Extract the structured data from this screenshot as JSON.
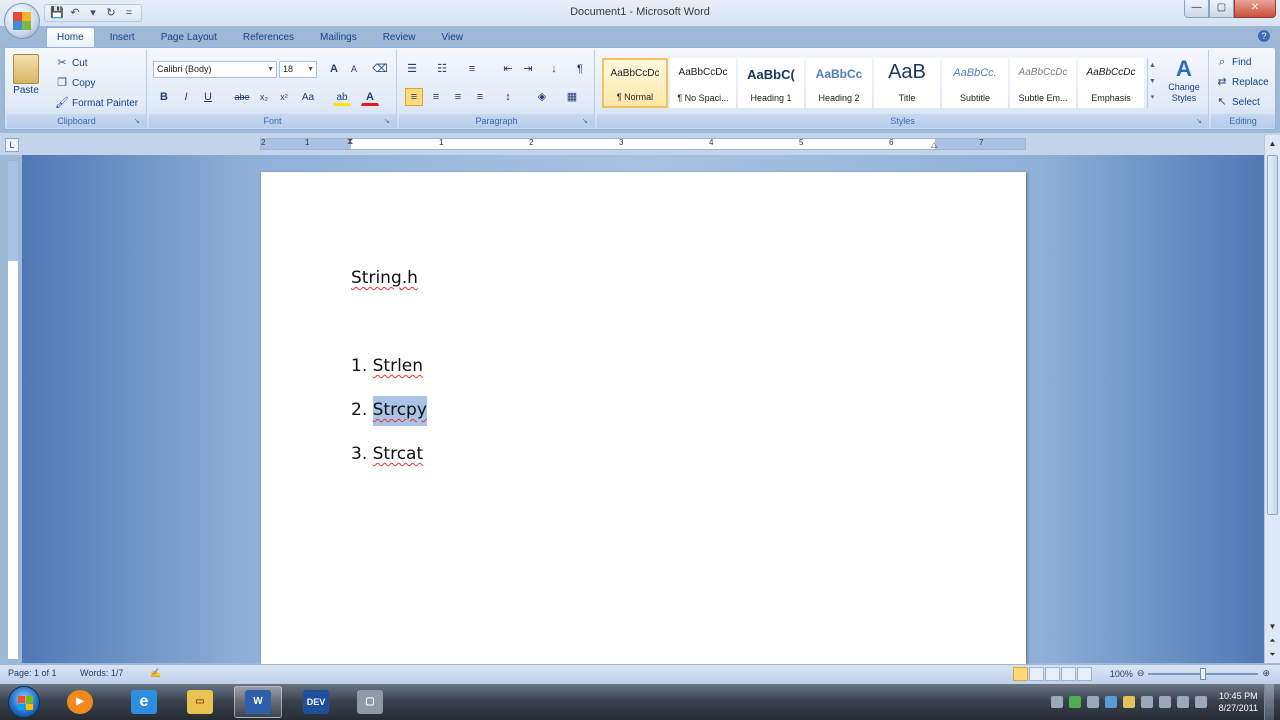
{
  "window": {
    "title": "Document1 - Microsoft Word",
    "controls": [
      "—",
      "▢",
      "✕"
    ]
  },
  "quick_access": [
    "💾",
    "↶",
    "▾",
    "↻",
    "="
  ],
  "tabs": [
    "Home",
    "Insert",
    "Page Layout",
    "References",
    "Mailings",
    "Review",
    "View"
  ],
  "active_tab": "Home",
  "clipboard": {
    "paste": "Paste",
    "cut": "Cut",
    "copy": "Copy",
    "format_painter": "Format Painter",
    "group": "Clipboard"
  },
  "font": {
    "name": "Calibri (Body)",
    "size": "18",
    "group": "Font",
    "buttons": {
      "grow": "A",
      "shrink": "A",
      "clear": "⌫",
      "bold": "B",
      "italic": "I",
      "underline": "U",
      "strike": "abe",
      "sub": "x₂",
      "sup": "x²",
      "case": "Aa",
      "highlight": "ab",
      "color": "A"
    }
  },
  "paragraph": {
    "group": "Paragraph",
    "buttons": {
      "bullets": "☰",
      "numbering": "☷",
      "multilevel": "≡",
      "dec_indent": "⇤",
      "inc_indent": "⇥",
      "sort": "↓",
      "show_marks": "¶",
      "align_left": "≡",
      "center": "≡",
      "align_right": "≡",
      "justify": "≡",
      "spacing": "↕",
      "shading": "◈",
      "borders": "▦"
    }
  },
  "styles": {
    "group": "Styles",
    "items": [
      {
        "sample": "AaBbCcDc",
        "name": "¶ Normal"
      },
      {
        "sample": "AaBbCcDc",
        "name": "¶ No Spaci..."
      },
      {
        "sample": "AaBbC(",
        "name": "Heading 1"
      },
      {
        "sample": "AaBbCc",
        "name": "Heading 2"
      },
      {
        "sample": "AaB",
        "name": "Title"
      },
      {
        "sample": "AaBbCc.",
        "name": "Subtitle"
      },
      {
        "sample": "AaBbCcDc",
        "name": "Subtle Em..."
      },
      {
        "sample": "AaBbCcDc",
        "name": "Emphasis"
      }
    ],
    "change_styles": "Change Styles",
    "change_glyph": "A"
  },
  "editing": {
    "group": "Editing",
    "find": "Find",
    "replace": "Replace",
    "select": "Select"
  },
  "ruler": {
    "numbers": [
      "2",
      "1",
      "1",
      "2",
      "3",
      "4",
      "5",
      "6",
      "7"
    ],
    "tab_selector": "L"
  },
  "document": {
    "heading": "String.h",
    "list": [
      {
        "num": "1.",
        "text": "Strlen"
      },
      {
        "num": "2.",
        "text": "Strcpy"
      },
      {
        "num": "3.",
        "text": "Strcat"
      }
    ]
  },
  "status": {
    "page": "Page: 1 of 1",
    "words": "Words: 1/7",
    "zoom": "100%",
    "zoom_fraction": 1.0
  },
  "taskbar": {
    "apps": [
      {
        "name": "media",
        "glyph": "▶",
        "color": "#f08a1c"
      },
      {
        "name": "ie",
        "glyph": "e",
        "color": "#2b8ee0"
      },
      {
        "name": "explorer",
        "glyph": "▭",
        "color": "#e9c251"
      },
      {
        "name": "word",
        "glyph": "W",
        "color": "#2f5fa8"
      },
      {
        "name": "dev",
        "glyph": "DEV",
        "color": "#1e4f99"
      },
      {
        "name": "window",
        "glyph": "▢",
        "color": "#8e99aa"
      }
    ],
    "clock_time": "10:45 PM",
    "clock_date": "8/27/2011"
  }
}
